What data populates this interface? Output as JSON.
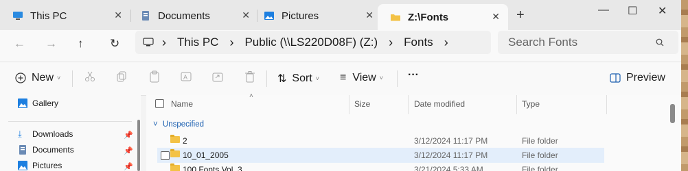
{
  "tabs": [
    {
      "label": "This PC",
      "icon": "computer-icon"
    },
    {
      "label": "Documents",
      "icon": "documents-icon"
    },
    {
      "label": "Pictures",
      "icon": "pictures-icon"
    },
    {
      "label": "Z:\\Fonts",
      "icon": "folder-icon",
      "active": true
    }
  ],
  "window": {
    "minimize": "—",
    "maximize": "☐",
    "close": "✕",
    "new_tab": "+"
  },
  "address": {
    "crumbs": [
      "This PC",
      "Public (\\\\LS220D08F) (Z:)",
      "Fonts"
    ],
    "search_placeholder": "Search Fonts"
  },
  "toolbar": {
    "new_label": "New",
    "sort_label": "Sort",
    "view_label": "View",
    "more_label": "···",
    "preview_label": "Preview"
  },
  "nav": {
    "gallery": "Gallery",
    "downloads": "Downloads",
    "documents": "Documents",
    "pictures": "Pictures"
  },
  "columns": {
    "name": "Name",
    "size": "Size",
    "date": "Date modified",
    "type": "Type"
  },
  "group_label": "Unspecified",
  "files": [
    {
      "name": "2",
      "date": "3/12/2024 11:17 PM",
      "type": "File folder"
    },
    {
      "name": "10_01_2005",
      "date": "3/12/2024 11:17 PM",
      "type": "File folder"
    },
    {
      "name": "100 Fonts Vol. 3",
      "date": "3/21/2024 5:33 AM",
      "type": "File folder"
    }
  ],
  "colors": {
    "accent": "#1b5fb0",
    "selected_row": "#e3eefb",
    "folder": "#f3c246"
  }
}
